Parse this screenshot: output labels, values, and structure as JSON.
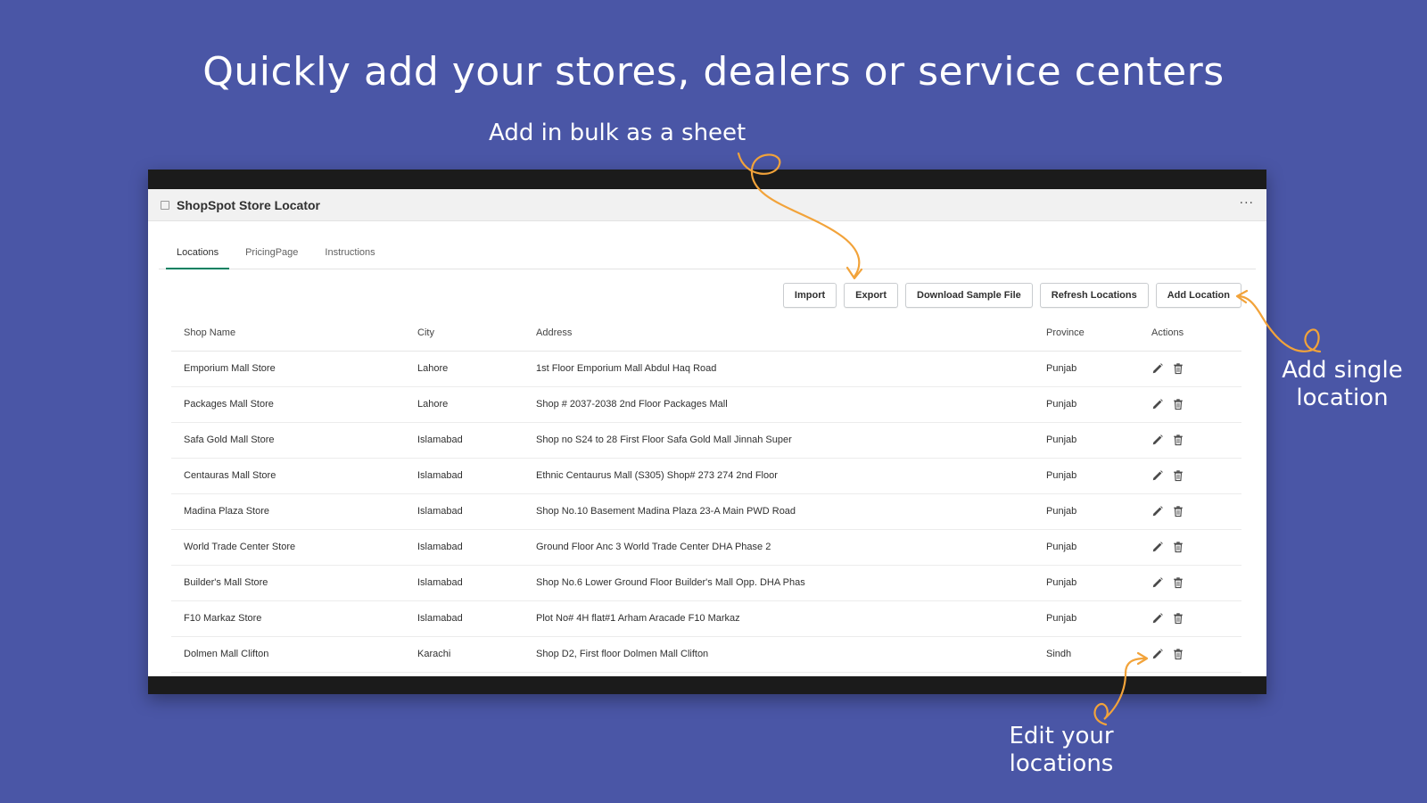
{
  "headline": "Quickly add your stores, dealers or service centers",
  "callouts": {
    "bulk": "Add in bulk as a sheet",
    "single_line1": "Add single",
    "single_line2": "location",
    "edit_line1": "Edit your",
    "edit_line2": "locations"
  },
  "app": {
    "title": "ShopSpot Store Locator",
    "more_label": "···"
  },
  "tabs": [
    {
      "label": "Locations",
      "active": true
    },
    {
      "label": "PricingPage",
      "active": false
    },
    {
      "label": "Instructions",
      "active": false
    }
  ],
  "toolbar": {
    "import_label": "Import",
    "export_label": "Export",
    "download_sample_label": "Download Sample File",
    "refresh_label": "Refresh Locations",
    "add_location_label": "Add Location"
  },
  "table": {
    "headers": [
      "Shop Name",
      "City",
      "Address",
      "Province",
      "Actions"
    ],
    "rows": [
      {
        "shop": "Emporium Mall Store",
        "city": "Lahore",
        "address": "1st Floor Emporium Mall Abdul Haq Road",
        "province": "Punjab"
      },
      {
        "shop": "Packages Mall Store",
        "city": "Lahore",
        "address": "Shop # 2037-2038 2nd Floor Packages Mall",
        "province": "Punjab"
      },
      {
        "shop": "Safa Gold Mall Store",
        "city": "Islamabad",
        "address": "Shop no S24 to 28 First Floor Safa Gold Mall Jinnah Super",
        "province": "Punjab"
      },
      {
        "shop": "Centauras Mall Store",
        "city": "Islamabad",
        "address": "Ethnic Centaurus Mall (S305) Shop# 273 274 2nd Floor",
        "province": "Punjab"
      },
      {
        "shop": "Madina Plaza Store",
        "city": "Islamabad",
        "address": "Shop No.10 Basement Madina Plaza 23-A Main PWD Road",
        "province": "Punjab"
      },
      {
        "shop": "World Trade Center Store",
        "city": "Islamabad",
        "address": "Ground Floor Anc 3 World Trade Center DHA Phase 2",
        "province": "Punjab"
      },
      {
        "shop": "Builder's Mall Store",
        "city": "Islamabad",
        "address": "Shop No.6 Lower Ground Floor Builder's Mall Opp. DHA Phas",
        "province": "Punjab"
      },
      {
        "shop": "F10 Markaz Store",
        "city": "Islamabad",
        "address": "Plot No# 4H flat#1 Arham Aracade F10 Markaz",
        "province": "Punjab"
      },
      {
        "shop": "Dolmen Mall Clifton",
        "city": "Karachi",
        "address": "Shop D2, First floor Dolmen Mall Clifton",
        "province": "Sindh"
      }
    ]
  },
  "colors": {
    "background": "#4a56a6",
    "arrow": "#f2a33a",
    "tab_active": "#008060"
  },
  "icons": {
    "edit": "pencil-icon",
    "delete": "trash-icon",
    "app": "store-icon",
    "more": "more-horizontal-icon"
  }
}
